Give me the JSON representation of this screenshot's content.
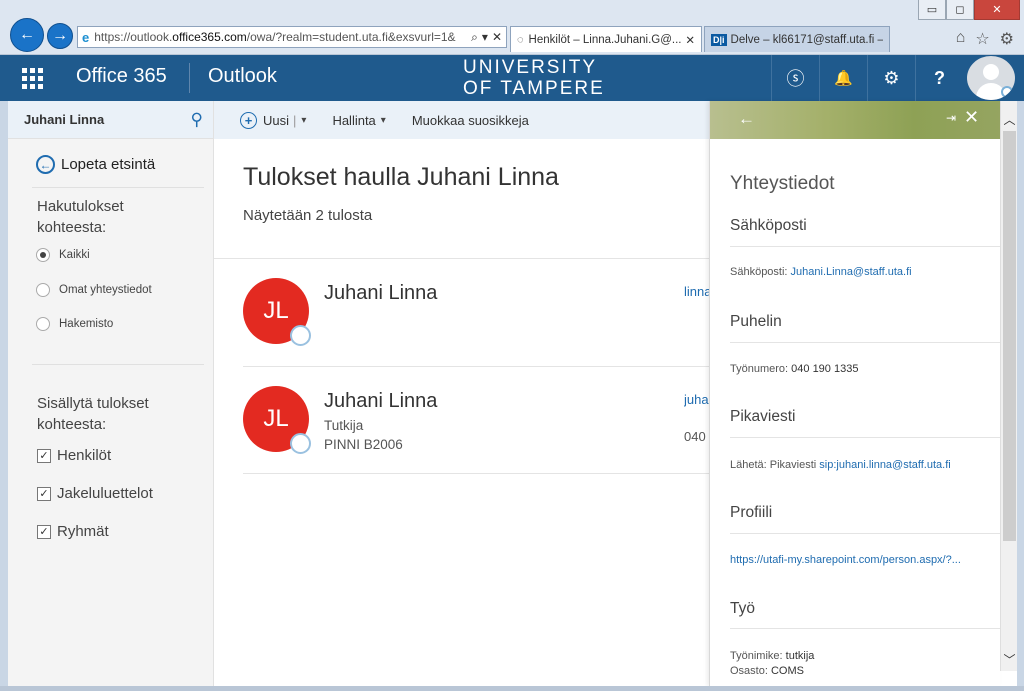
{
  "browser": {
    "window_controls": {
      "minimize": "▭",
      "maximize": "◻",
      "close": "✕"
    },
    "back_glyph": "←",
    "forward_glyph": "→",
    "address": {
      "prefix": "https://outlook.",
      "domain": "office365.com",
      "suffix": "/owa/?realm=student.uta.fi&exsvurl=1&"
    },
    "address_tools": {
      "search": "⌕",
      "dropdown": "▾",
      "stop": "✕"
    },
    "tabs": [
      {
        "label": "Henkilöt – Linna.Juhani.G@...",
        "close": "✕",
        "active": true
      },
      {
        "label": "Delve – kl66171@staff.uta.fi – ...",
        "badge": "D|i",
        "active": false
      }
    ],
    "right_tools": {
      "home": "⌂",
      "star": "☆",
      "settings": "⚙"
    }
  },
  "topbar": {
    "suite_title": "Office 365",
    "app_title": "Outlook",
    "logo_line1": "UNIVERSITY",
    "logo_line2": "OF TAMPERE",
    "icons": {
      "skype": "ⓢ",
      "bell": "🔔",
      "gear": "⚙",
      "help": "?"
    }
  },
  "left_pane": {
    "search_value": "Juhani Linna",
    "stop_search": "Lopeta etsintä",
    "results_from_title": "Hakutulokset kohteesta:",
    "result_sources": [
      {
        "label": "Kaikki",
        "selected": true
      },
      {
        "label": "Omat yhteystiedot",
        "selected": false
      },
      {
        "label": "Hakemisto",
        "selected": false
      }
    ],
    "include_title": "Sisällytä tulokset kohteesta:",
    "include_options": [
      {
        "label": "Henkilöt",
        "checked": true
      },
      {
        "label": "Jakeluluettelot",
        "checked": true
      },
      {
        "label": "Ryhmät",
        "checked": true
      }
    ]
  },
  "toolbar": {
    "new_label": "Uusi",
    "manage_label": "Hallinta",
    "edit_favorites_label": "Muokkaa suosikkeja"
  },
  "results": {
    "title": "Tulokset haulla Juhani Linna",
    "count_text": "Näytetään 2 tulosta",
    "people": [
      {
        "initials": "JL",
        "name": "Juhani Linna",
        "title": "",
        "location": "",
        "email_fragment": "linna",
        "phone_fragment": ""
      },
      {
        "initials": "JL",
        "name": "Juhani Linna",
        "title": "Tutkija",
        "location": "PINNI B2006",
        "email_fragment": "juha",
        "phone_fragment": "040"
      }
    ]
  },
  "contact_card": {
    "back_glyph": "←",
    "pin_glyph": "⇥",
    "close_glyph": "✕",
    "heading": "Yhteystiedot",
    "email_section": "Sähköposti",
    "email_label": "Sähköposti:",
    "email_value": "Juhani.Linna@staff.uta.fi",
    "phone_section": "Puhelin",
    "phone_label": "Työnumero:",
    "phone_value": "040 190 1335",
    "im_section": "Pikaviesti",
    "im_label": "Lähetä: Pikaviesti",
    "im_value": "sip:juhani.linna@staff.uta.fi",
    "profile_section": "Profiili",
    "profile_link": "https://utafi-my.sharepoint.com/person.aspx/?...",
    "work_section": "Työ",
    "job_title_label": "Työnimike:",
    "job_title_value": "tutkija",
    "department_label": "Osasto:",
    "department_value": "COMS"
  },
  "colors": {
    "topbar": "#1f5a8d",
    "accent": "#1f6cb0",
    "avatar_red": "#e32a21"
  }
}
